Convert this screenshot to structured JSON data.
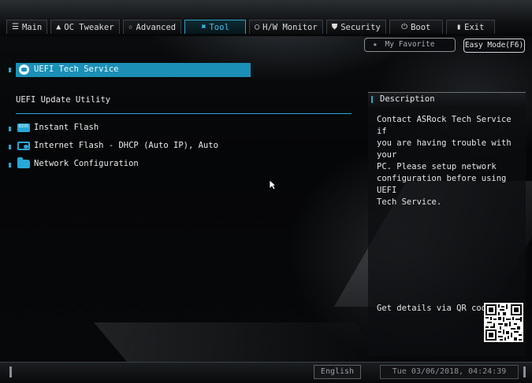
{
  "nav": {
    "tabs": [
      {
        "label": "Main",
        "icon": "list-icon"
      },
      {
        "label": "OC Tweaker",
        "icon": "rocket-icon"
      },
      {
        "label": "Advanced",
        "icon": "star-icon"
      },
      {
        "label": "Tool",
        "icon": "tools-icon",
        "active": true
      },
      {
        "label": "H/W Monitor",
        "icon": "monitor-icon"
      },
      {
        "label": "Security",
        "icon": "shield-icon"
      },
      {
        "label": "Boot",
        "icon": "power-icon"
      },
      {
        "label": "Exit",
        "icon": "exit-icon"
      }
    ],
    "favorite_label": "My Favorite",
    "easy_mode_label": "Easy Mode(F6)"
  },
  "main": {
    "selected_item": "UEFI Tech Service",
    "section_title": "UEFI Update Utility",
    "items": [
      {
        "label": "Instant Flash",
        "icon": "instant-flash-icon"
      },
      {
        "label": "Internet Flash - DHCP (Auto IP), Auto",
        "icon": "internet-flash-icon"
      },
      {
        "label": "Network Configuration",
        "icon": "folder-icon"
      }
    ]
  },
  "description": {
    "title": "Description",
    "text": "Contact ASRock Tech Service if\nyou are having trouble with your\nPC. Please setup network\nconfiguration before using UEFI\nTech Service.",
    "qr_label": "Get details via QR code"
  },
  "footer": {
    "language": "English",
    "datetime": "Tue 03/06/2018, 04:24:39"
  },
  "colors": {
    "accent": "#2aa6cc",
    "selected": "#1c8fb6"
  }
}
